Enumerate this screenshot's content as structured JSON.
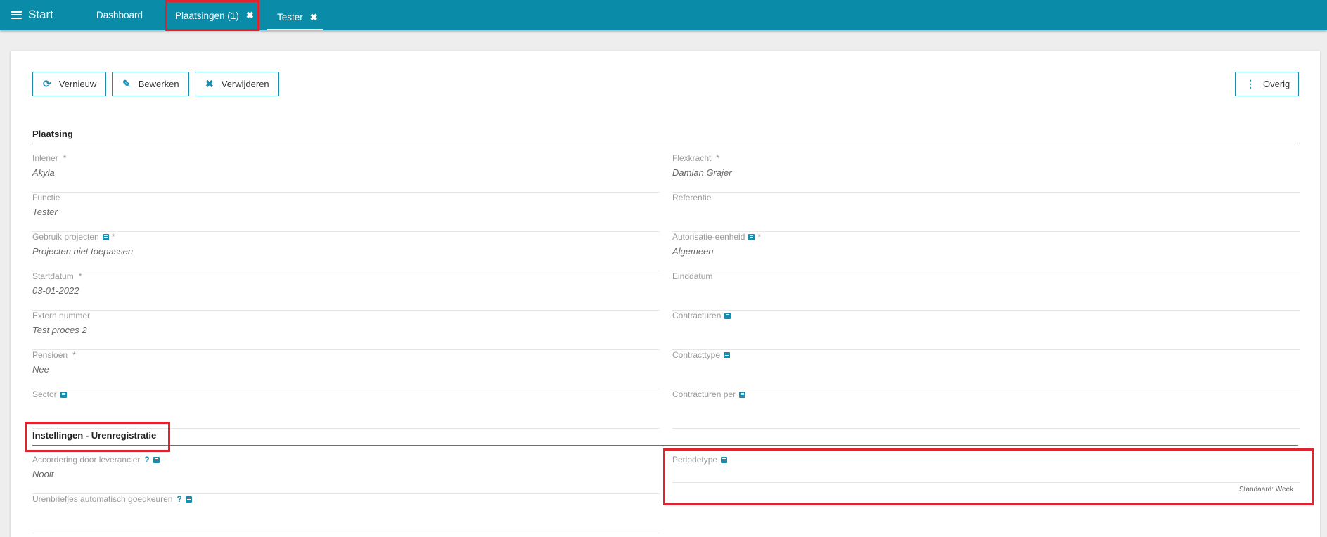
{
  "topbar": {
    "start_label": "Start",
    "nav_dashboard": "Dashboard",
    "tabs": [
      {
        "label": "Plaatsingen (1)",
        "close": "✖"
      },
      {
        "label": "Tester",
        "close": "✖"
      }
    ]
  },
  "toolbar": {
    "refresh_label": "Vernieuw",
    "refresh_icon": "⟳",
    "edit_label": "Bewerken",
    "edit_icon": "✎",
    "delete_label": "Verwijderen",
    "delete_icon": "✖",
    "more_label": "Overig",
    "more_icon": "⋮"
  },
  "sections": {
    "plaatsing": {
      "title": "Plaatsing",
      "left": [
        {
          "label": "Inlener",
          "value": "Akyla",
          "required": "*"
        },
        {
          "label": "Functie",
          "value": "Tester"
        },
        {
          "label": "Gebruik projecten",
          "value": "Projecten niet toepassen",
          "required": "*"
        },
        {
          "label": "Startdatum",
          "value": "03-01-2022",
          "required": "*"
        },
        {
          "label": "Extern nummer",
          "value": "Test proces 2"
        },
        {
          "label": "Pensioen",
          "value": "Nee",
          "required": "*"
        },
        {
          "label": "Sector",
          "value": ""
        }
      ],
      "right": [
        {
          "label": "Flexkracht",
          "value": "Damian Grajer",
          "required": "*"
        },
        {
          "label": "Referentie",
          "value": ""
        },
        {
          "label": "Autorisatie-eenheid",
          "value": "Algemeen",
          "required": "*"
        },
        {
          "label": "Einddatum",
          "value": ""
        },
        {
          "label": "Contracturen",
          "value": ""
        },
        {
          "label": "Contracttype",
          "value": ""
        },
        {
          "label": "Contracturen per",
          "value": ""
        }
      ]
    },
    "urenregistratie": {
      "title": "Instellingen - Urenregistratie",
      "left": [
        {
          "label": "Accordering door leverancier",
          "value": "Nooit",
          "help": "?"
        },
        {
          "label": "Urenbriefjes automatisch goedkeuren",
          "value": "",
          "help": "?"
        }
      ],
      "right": [
        {
          "label": "Periodetype",
          "value": "",
          "hint": "Standaard: Week"
        }
      ]
    }
  },
  "colors": {
    "topbar": "#0a8ba8",
    "accent": "#1a8cae",
    "highlight": "#e0232e"
  }
}
